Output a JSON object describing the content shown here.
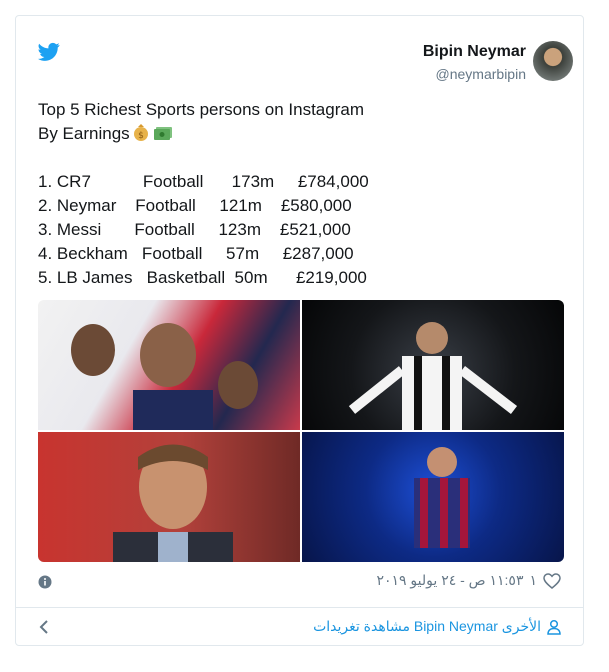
{
  "author": {
    "name": "Bipin Neymar",
    "handle": "@neymarbipin"
  },
  "tweet": {
    "lines": [
      "Top 5 Richest Sports persons on Instagram",
      "By Earnings",
      "",
      "1. CR7           Football      173m     £784,000",
      "2. Neymar    Football     121m    £580,000",
      "3. Messi       Football     123m    £521,000",
      "4. Beckham   Football     57m     £287,000",
      "5. LB James   Basketball  50m      £219,000"
    ],
    "emojis": [
      "money-bag",
      "money-with-wings"
    ]
  },
  "media": {
    "images": [
      "cr7-neymar-messi-collage",
      "ronaldo-juventus",
      "beckham-portrait",
      "messi-barcelona"
    ]
  },
  "footer": {
    "like_count": "١",
    "timestamp": "١١:٥٣ ص - ٢٤ يوليو ٢٠١٩"
  },
  "more": {
    "label": "مشاهدة تغريدات Bipin Neymar الأخرى"
  },
  "colors": {
    "link": "#1b95e0",
    "secondary": "#657786",
    "border": "#e1e8ed"
  }
}
